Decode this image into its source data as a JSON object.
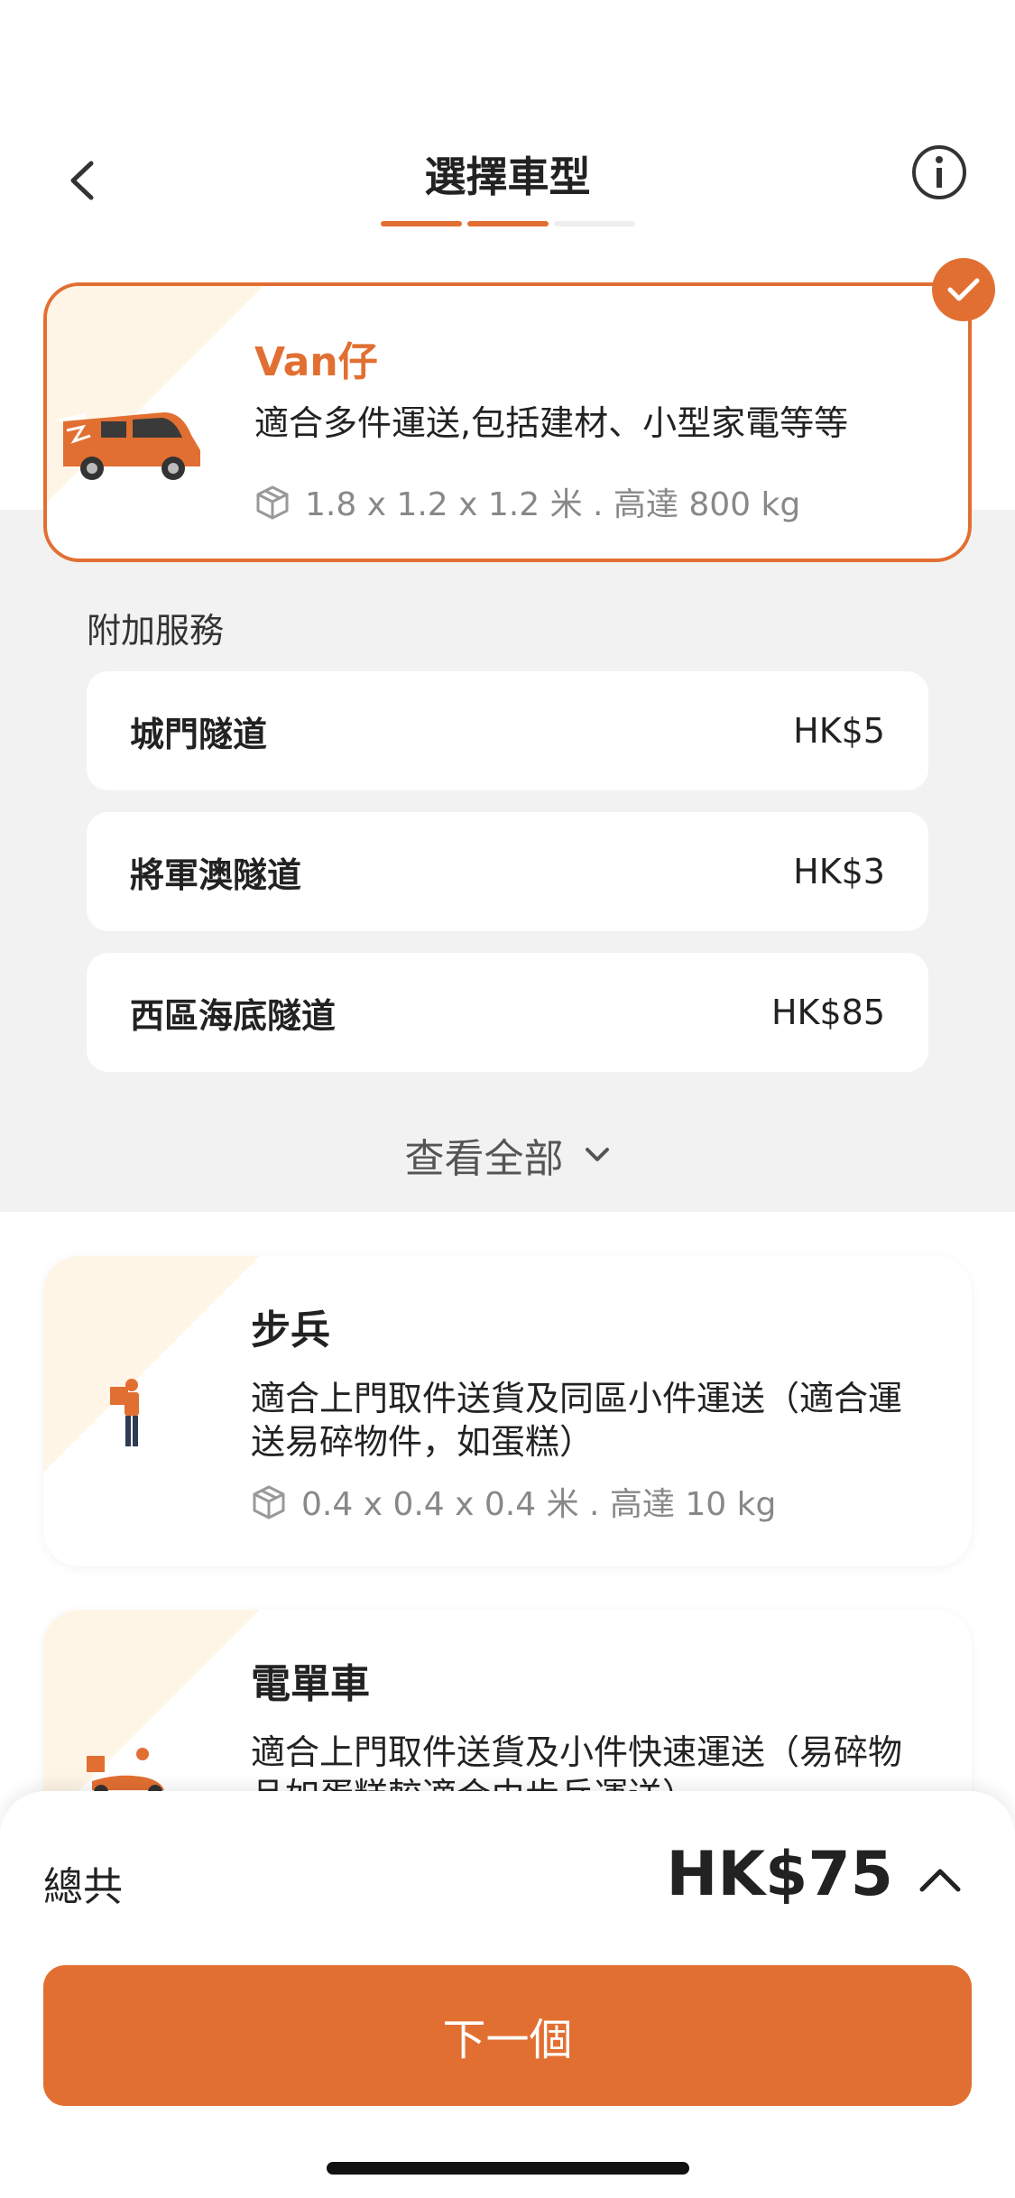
{
  "header": {
    "title": "選擇車型",
    "steps_total": 3,
    "steps_completed": 2
  },
  "selected_vehicle": {
    "name": "Van仔",
    "description": "適合多件運送,包括建材、小型家電等等",
    "spec": "1.8 x 1.2 x 1.2 米 . 高達 800 kg"
  },
  "addons": {
    "title": "附加服務",
    "items": [
      {
        "name": "城門隧道",
        "price": "HK$5"
      },
      {
        "name": "將軍澳隧道",
        "price": "HK$3"
      },
      {
        "name": "西區海底隧道",
        "price": "HK$85"
      }
    ],
    "view_all": "查看全部"
  },
  "vehicles": [
    {
      "name": "步兵",
      "description": "適合上門取件送貨及同區小件運送（適合運送易碎物件，如蛋糕）",
      "spec": "0.4 x 0.4 x 0.4 米 . 高達 10 kg"
    },
    {
      "name": "電單車",
      "description": "適合上門取件送貨及小件快速運送（易碎物品如蛋糕較適合由步兵運送）"
    }
  ],
  "footer": {
    "total_label": "總共",
    "total_value": "HK$75",
    "next_label": "下一個"
  },
  "colors": {
    "accent": "#E26F32",
    "corner": "#FFF5E6",
    "band": "#F2F2F2"
  }
}
